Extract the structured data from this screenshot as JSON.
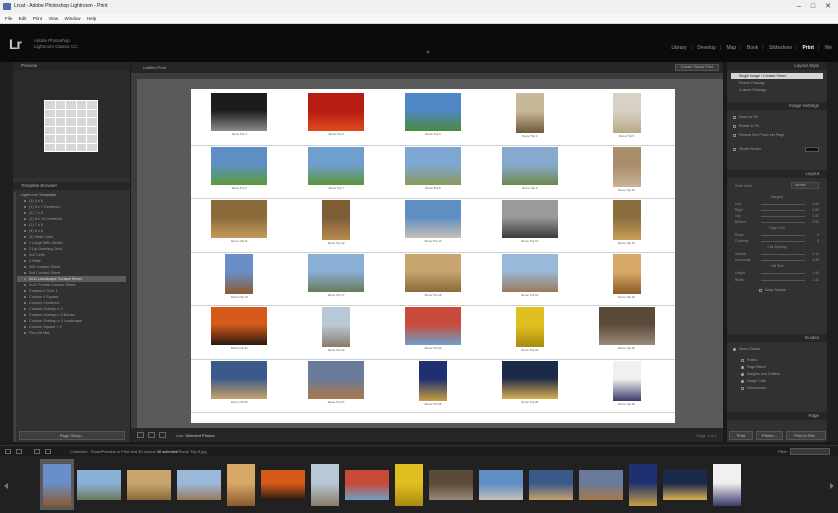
{
  "window": {
    "title": "Lrcat - Adobe Photoshop Lightroom - Print",
    "menu": [
      "File",
      "Edit",
      "Print",
      "View",
      "Window",
      "Help"
    ],
    "minimize": "–",
    "maximize": "□",
    "close": "✕"
  },
  "identity": {
    "logo": "Lr",
    "line1": "Adobe Photoshop",
    "line2": "Lightroom Classic CC"
  },
  "modules": [
    "Library",
    "Develop",
    "Map",
    "Book",
    "Slideshow",
    "Print",
    "We"
  ],
  "active_module": "Print",
  "left_panel": {
    "preview_title": "Preview",
    "template_browser_title": "Template Browser",
    "templates": [
      {
        "label": "Lightroom Templates",
        "folder": true
      },
      {
        "label": "(1) 4 x 6",
        "folder": false
      },
      {
        "label": "(1) 5 x 7 Centered",
        "folder": false
      },
      {
        "label": "(1) 7 x 5",
        "folder": false
      },
      {
        "label": "(1) 8 x 10 Centered",
        "folder": false
      },
      {
        "label": "(2) 7 x 5",
        "folder": false
      },
      {
        "label": "(4) 5 x 6",
        "folder": false
      },
      {
        "label": "(4) Wide Cells",
        "folder": false
      },
      {
        "label": "1 Large With Stroke",
        "folder": false
      },
      {
        "label": "2 Up Greeting Card",
        "folder": false
      },
      {
        "label": "2x2 Cells",
        "folder": false
      },
      {
        "label": "4 Wide",
        "folder": false
      },
      {
        "label": "4x5 Contact Sheet",
        "folder": false
      },
      {
        "label": "5x8 Contact Sheet",
        "folder": false
      },
      {
        "label": "5x11 Landscape Contact Sheet",
        "folder": false
      },
      {
        "label": "5x11 Portrait Contact Sheet",
        "folder": false
      },
      {
        "label": "Custom 2 Over 1",
        "folder": false
      },
      {
        "label": "Custom 4 Square",
        "folder": false
      },
      {
        "label": "Custom Centered",
        "folder": false
      },
      {
        "label": "Custom Overlap x 3",
        "folder": false
      },
      {
        "label": "Custom Overlap x 3 Border",
        "folder": false
      },
      {
        "label": "Custom Overlap x 3 Landscape",
        "folder": false
      },
      {
        "label": "Custom Square + 2",
        "folder": false
      },
      {
        "label": "Fine Art Mat",
        "folder": false
      }
    ],
    "selected_template_index": 14,
    "page_setup": "Page Setup..."
  },
  "center": {
    "toolbar_label": "Untitled Print",
    "create_saved_print": "Create Saved Print",
    "captions": [
      "Rome Trip 1",
      "Rome Trip 2",
      "Rome Trip 3",
      "Rome Trip 4",
      "Rome Trip 5",
      "Rome Trip 6",
      "Rome Trip 7",
      "Rome Trip 8",
      "Rome Trip 9",
      "Rome Trip 10",
      "Rome Trip 11",
      "Rome Trip 12",
      "Rome Trip 13",
      "Rome Trip 14",
      "Rome Trip 15",
      "Rome Trip 16",
      "Rome Trip 17",
      "Rome Trip 18",
      "Rome Trip 19",
      "Rome Trip 20",
      "Rome Trip 21",
      "Rome Trip 22",
      "Rome Trip 23",
      "Rome Trip 24",
      "Rome Trip 25",
      "Rome Trip 26",
      "Rome Trip 27",
      "Rome Trip 28",
      "Rome Trip 29",
      "Rome Trip 30"
    ],
    "use_label": "Use:",
    "use_value": "Selected Photos",
    "page_label": "Page 1 of 1"
  },
  "right_panel": {
    "layout_style_title": "Layout Style",
    "layout_styles": [
      "Single Image / Contact Sheet",
      "Picture Package",
      "Custom Package"
    ],
    "image_settings_title": "Image Settings",
    "image_settings": [
      "Zoom to Fill",
      "Rotate to Fit",
      "Repeat One Photo per Page",
      "Stroke Border"
    ],
    "layout_title": "Layout",
    "ruler_units_label": "Ruler Units",
    "ruler_units_value": "Inches",
    "margins_label": "Margins",
    "margins": [
      {
        "label": "Left",
        "value": "0.50"
      },
      {
        "label": "Right",
        "value": "0.50"
      },
      {
        "label": "Top",
        "value": "0.50"
      },
      {
        "label": "Bottom",
        "value": "0.50"
      }
    ],
    "page_grid_label": "Page Grid",
    "page_grid": [
      {
        "label": "Rows",
        "value": "6"
      },
      {
        "label": "Columns",
        "value": "5"
      }
    ],
    "cell_spacing_label": "Cell Spacing",
    "cell_spacing": [
      {
        "label": "Vertical",
        "value": "0.14"
      },
      {
        "label": "Horizontal",
        "value": "0.25"
      }
    ],
    "cell_size_label": "Cell Size",
    "cell_size": [
      {
        "label": "Height",
        "value": "1.44"
      },
      {
        "label": "Width",
        "value": "1.40"
      }
    ],
    "keep_square": "Keep Square",
    "guides_title": "Guides",
    "show_guides": "Show Guides",
    "guide_options": [
      {
        "label": "Rulers",
        "checked": false
      },
      {
        "label": "Page Bleed",
        "checked": true
      },
      {
        "label": "Margins and Gutters",
        "checked": true
      },
      {
        "label": "Image Cells",
        "checked": true
      },
      {
        "label": "Dimensions",
        "checked": false
      }
    ],
    "page_title": "Page",
    "print_button": "Print",
    "printer_button": "Printer...",
    "print_to_file": "Print to File..."
  },
  "filmstrip_bar": {
    "info_prefix": "Collection : SmartPreview in Print fold",
    "photos_label": "30 photos",
    "selected_label": "30 selected",
    "file_label": "/Rome Trip 9.jpg",
    "filter_label": "Filter:"
  }
}
